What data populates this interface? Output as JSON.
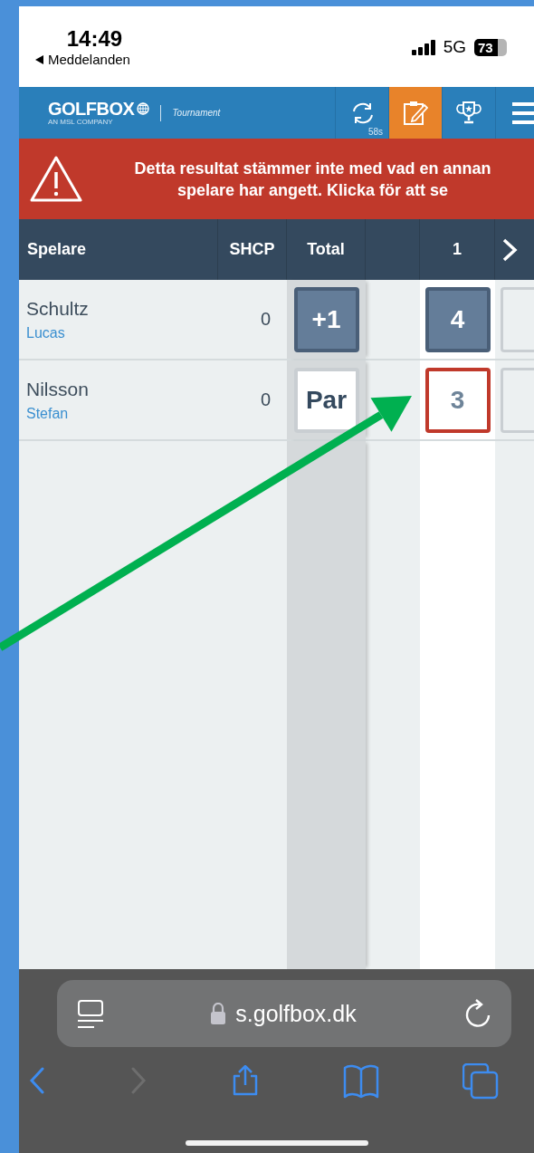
{
  "status_bar": {
    "time": "14:49",
    "back_app": "Meddelanden",
    "network": "5G",
    "battery": "73"
  },
  "nav": {
    "logo": "GOLFBOX",
    "logo_sub": "AN MSL COMPANY",
    "product": "Tournament",
    "items": [
      {
        "kind": "refresh",
        "label": "58s",
        "selected": false
      },
      {
        "kind": "scorecard",
        "selected": true
      },
      {
        "kind": "trophy",
        "selected": false
      },
      {
        "kind": "menu",
        "selected": false
      }
    ]
  },
  "alert": {
    "text": "Detta resultat stämmer inte med vad en annan spelare har angett. Klicka för att se"
  },
  "table": {
    "columns": [
      "Spelare",
      "SHCP",
      "Total",
      "1"
    ],
    "rows": [
      {
        "last_name": "Schultz",
        "first_name": "Lucas",
        "shcp": "0",
        "total": {
          "text": "+1",
          "kind": "filled"
        },
        "hole": {
          "text": "4",
          "kind": "filled",
          "conflict": false
        }
      },
      {
        "last_name": "Nilsson",
        "first_name": "Stefan",
        "shcp": "0",
        "total": {
          "text": "Par",
          "kind": "plain"
        },
        "hole": {
          "text": "3",
          "kind": "plain",
          "conflict": true
        }
      }
    ]
  },
  "browser": {
    "url": "s.golfbox.dk",
    "toolbar": [
      {
        "kind": "back",
        "disabled": false
      },
      {
        "kind": "forward",
        "disabled": true
      },
      {
        "kind": "share",
        "disabled": false
      },
      {
        "kind": "bookmarks",
        "disabled": false
      },
      {
        "kind": "tabs",
        "disabled": false
      }
    ]
  }
}
